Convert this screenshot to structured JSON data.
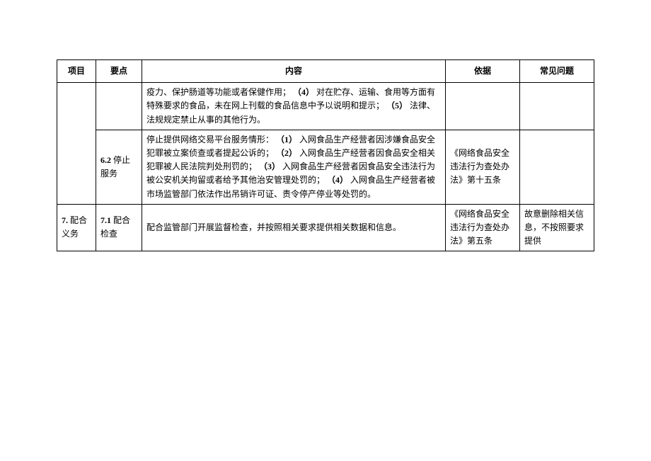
{
  "headers": {
    "project": "项目",
    "point": "要点",
    "content": "内容",
    "basis": "依据",
    "issue": "常见问题"
  },
  "rows": [
    {
      "project": "",
      "point": "",
      "content_prefix": "疫力、保护肠道等功能或者保健作用；",
      "content_b4": "（4）",
      "content_mid4": "对在贮存、运输、食用等方面有特殊要求的食品，未在网上刊载的食品信息中予以说明和提示；",
      "content_b5": "（5）",
      "content_end": "法律、法规规定禁止从事的其他行为。",
      "basis": "",
      "issue": ""
    },
    {
      "project": "",
      "point_b": "6.2",
      "point_t": " 停止服务",
      "content_prefix": "停止提供网络交易平台服务情形：",
      "content_b1": "（1）",
      "content_t1": "入网食品生产经营者因涉嫌食品安全犯罪被立案侦查或者提起公诉的；",
      "content_b2": "（2）",
      "content_t2": "入网食品生产经营者因食品安全相关犯罪被人民法院判处刑罚的；",
      "content_b3": "（3）",
      "content_t3": "入网食品生产经营者因食品安全违法行为被公安机关拘留或者给予其他治安管理处罚的；",
      "content_b4": "（4）",
      "content_t4": "入网食品生产经营者被市场监管部门依法作出吊销许可证、责令停产停业等处罚的。",
      "basis": "《网络食品安全违法行为查处办法》第十五条",
      "issue": ""
    },
    {
      "project_b": "7.",
      "project_t": " 配合义务",
      "point_b": "7.1",
      "point_t": " 配合检查",
      "content": "配合监管部门开展监督检查，并按照相关要求提供相关数据和信息。",
      "basis": "《网络食品安全违法行为查处办法》第五条",
      "issue": "故意删除相关信息，不按照要求提供"
    }
  ]
}
